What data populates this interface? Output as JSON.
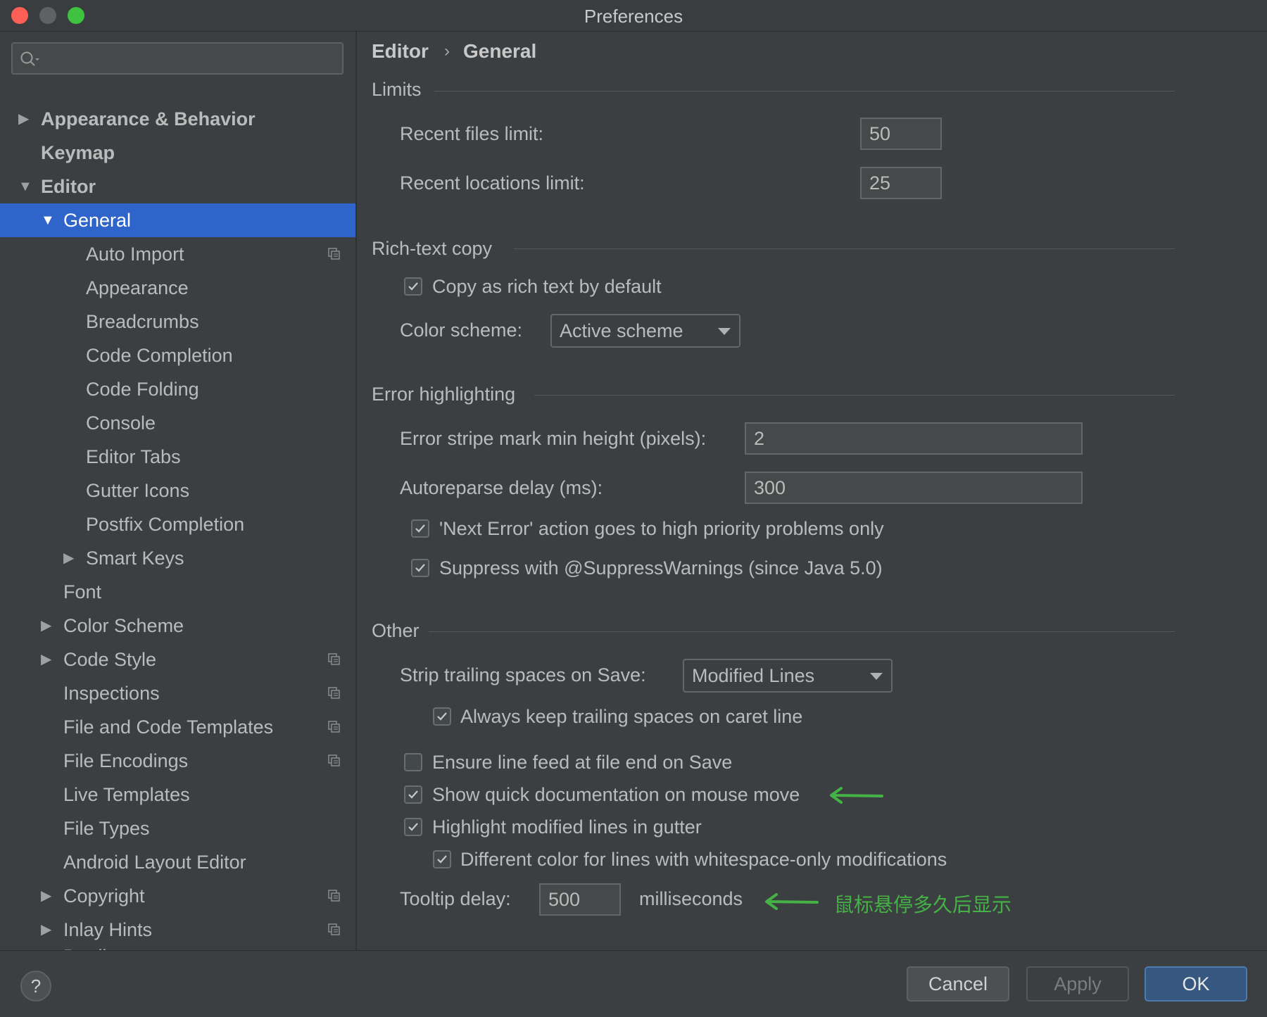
{
  "window": {
    "title": "Preferences"
  },
  "sidebar": {
    "search": {
      "placeholder": "",
      "value": ""
    },
    "items": [
      {
        "label": "Appearance & Behavior",
        "arrow": "▶"
      },
      {
        "label": "Keymap",
        "arrow": ""
      },
      {
        "label": "Editor",
        "arrow": "▼"
      },
      {
        "label": "General",
        "arrow": "▼"
      },
      {
        "label": "Auto Import",
        "arrow": ""
      },
      {
        "label": "Appearance",
        "arrow": ""
      },
      {
        "label": "Breadcrumbs",
        "arrow": ""
      },
      {
        "label": "Code Completion",
        "arrow": ""
      },
      {
        "label": "Code Folding",
        "arrow": ""
      },
      {
        "label": "Console",
        "arrow": ""
      },
      {
        "label": "Editor Tabs",
        "arrow": ""
      },
      {
        "label": "Gutter Icons",
        "arrow": ""
      },
      {
        "label": "Postfix Completion",
        "arrow": ""
      },
      {
        "label": "Smart Keys",
        "arrow": "▶"
      },
      {
        "label": "Font",
        "arrow": ""
      },
      {
        "label": "Color Scheme",
        "arrow": "▶"
      },
      {
        "label": "Code Style",
        "arrow": "▶"
      },
      {
        "label": "Inspections",
        "arrow": ""
      },
      {
        "label": "File and Code Templates",
        "arrow": ""
      },
      {
        "label": "File Encodings",
        "arrow": ""
      },
      {
        "label": "Live Templates",
        "arrow": ""
      },
      {
        "label": "File Types",
        "arrow": ""
      },
      {
        "label": "Android Layout Editor",
        "arrow": ""
      },
      {
        "label": "Copyright",
        "arrow": "▶"
      },
      {
        "label": "Inlay Hints",
        "arrow": "▶"
      },
      {
        "label": "Duplicates",
        "arrow": ""
      }
    ]
  },
  "breadcrumb": {
    "parent": "Editor",
    "separator": "›",
    "current": "General"
  },
  "limits": {
    "title": "Limits",
    "recent_files_label": "Recent files limit:",
    "recent_files_value": "50",
    "recent_locations_label": "Recent locations limit:",
    "recent_locations_value": "25"
  },
  "rich_text": {
    "title": "Rich-text copy",
    "copy_label": "Copy as rich text by default",
    "copy_checked": true,
    "color_scheme_label": "Color scheme:",
    "color_scheme_value": "Active scheme"
  },
  "error_highlighting": {
    "title": "Error highlighting",
    "stripe_label": "Error stripe mark min height (pixels):",
    "stripe_value": "2",
    "autoreparse_label": "Autoreparse delay (ms):",
    "autoreparse_value": "300",
    "next_error_label": "'Next Error' action goes to high priority problems only",
    "suppress_label": "Suppress with @SuppressWarnings (since Java 5.0)"
  },
  "other": {
    "title": "Other",
    "strip_label": "Strip trailing spaces on Save:",
    "strip_value": "Modified Lines",
    "keep_trailing_label": "Always keep trailing spaces on caret line",
    "ensure_line_feed_label": "Ensure line feed at file end on Save",
    "quick_doc_label": "Show quick documentation on mouse move",
    "highlight_modified_label": "Highlight modified lines in gutter",
    "different_color_label": "Different color for lines with whitespace-only modifications",
    "tooltip_label": "Tooltip delay:",
    "tooltip_value": "500",
    "tooltip_unit": "milliseconds"
  },
  "annotation": {
    "text": "鼠标悬停多久后显示",
    "color": "#44b245"
  },
  "buttons": {
    "help": "?",
    "cancel": "Cancel",
    "apply": "Apply",
    "ok": "OK"
  },
  "colors": {
    "accent": "#2f65ca",
    "ok_button": "#365880",
    "background": "#3c3f41"
  }
}
